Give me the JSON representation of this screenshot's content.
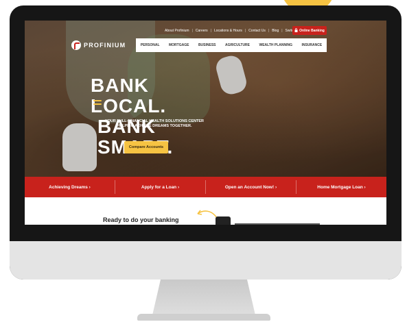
{
  "colors": {
    "brand_red": "#c8221c",
    "accent_yellow": "#f6c343",
    "bezel": "#161616"
  },
  "utility": {
    "links": [
      "About Profinium",
      "Careers",
      "Locations & Hours",
      "Contact Us",
      "Blog",
      "Switch Kit"
    ],
    "search_icon": "search-icon",
    "online_banking": "Online Banking",
    "lock_icon": "lock-icon"
  },
  "logo": {
    "text": "PROFINIUM"
  },
  "nav": {
    "items": [
      "PERSONAL",
      "MORTGAGE",
      "BUSINESS",
      "AGRICULTURE",
      "WEALTH PLANNING",
      "INSURANCE"
    ]
  },
  "hero": {
    "line1": "BANK LOCAL.",
    "line2": "BANK SMART.",
    "sub1": "YOUR FULL-FINANCIAL HEALTH SOLUTIONS CENTER",
    "sub2": "HELPING ACHIEVE DREAMS TOGETHER.",
    "cta": "Compare Accounts"
  },
  "quick_links": [
    "Achieving Dreams ›",
    "Apply for a Loan ›",
    "Open an Account Now! ›",
    "Home Mortgage Loan ›"
  ],
  "lower": {
    "heading": "Ready to do your banking"
  }
}
